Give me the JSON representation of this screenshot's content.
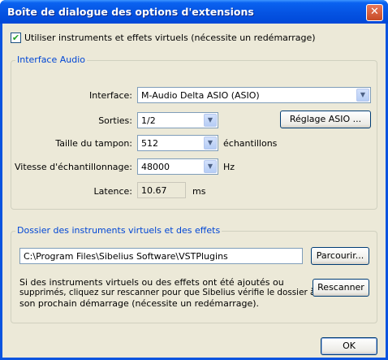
{
  "window": {
    "title": "Boîte de dialogue des options d'extensions",
    "close_glyph": "✕"
  },
  "use_virtual": {
    "checked": true,
    "label": "Utiliser instruments et effets virtuels (nécessite un redémarrage)"
  },
  "audio": {
    "group_title": "Interface Audio",
    "interface_label": "Interface:",
    "interface_value": "M-Audio Delta ASIO (ASIO)",
    "outputs_label": "Sorties:",
    "outputs_value": "1/2",
    "asio_button": "Réglage ASIO ...",
    "buffer_label": "Taille du tampon:",
    "buffer_value": "512",
    "buffer_unit": "échantillons",
    "rate_label": "Vitesse d'échantillonnage:",
    "rate_value": "48000",
    "rate_unit": "Hz",
    "latency_label": "Latence:",
    "latency_value": "10.67",
    "latency_unit": "ms"
  },
  "plugins": {
    "group_title": "Dossier des instruments virtuels et des effets",
    "path_value": "C:\\Program Files\\Sibelius Software\\VSTPlugins",
    "browse_button": "Parcourir...",
    "info_text_1": "Si des instruments virtuels ou des effets ont été ajoutés ou",
    "info_text_2": "supprimés, cliquez sur rescanner pour que Sibelius vérifie le dossier à",
    "info_text_3": "son prochain démarrage (nécessite un redémarrage).",
    "rescan_button": "Rescanner"
  },
  "footer": {
    "ok_button": "OK"
  },
  "icons": {
    "dropdown": "chevron-down-icon",
    "check": "checkmark-icon",
    "close": "close-icon"
  }
}
